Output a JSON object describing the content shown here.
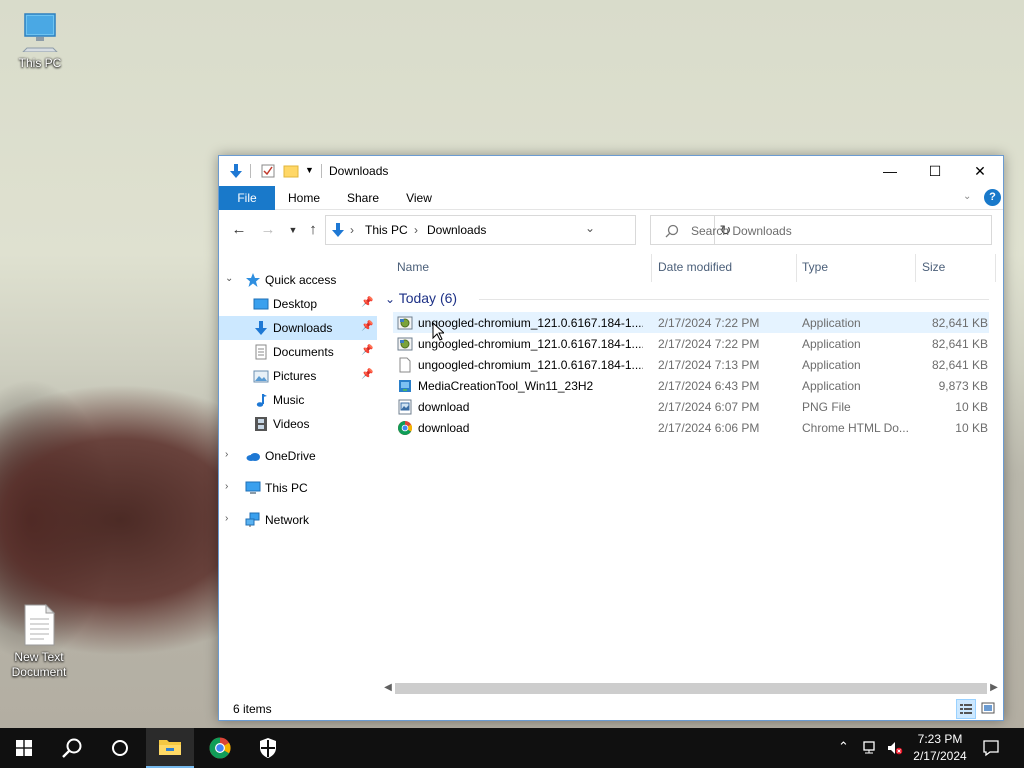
{
  "desktop": {
    "icons": [
      {
        "label": "This PC"
      },
      {
        "label": "New Text Document"
      }
    ]
  },
  "window": {
    "title": "Downloads",
    "controls": {
      "minimize": "—",
      "maximize": "☐",
      "close": "✕"
    }
  },
  "ribbon": {
    "tabs": [
      "File",
      "Home",
      "Share",
      "View"
    ],
    "help": "?"
  },
  "address": {
    "crumbs": [
      "This PC",
      "Downloads"
    ],
    "search_placeholder": "Search Downloads"
  },
  "navpane": {
    "items": [
      {
        "label": "Quick access"
      },
      {
        "label": "Desktop"
      },
      {
        "label": "Downloads"
      },
      {
        "label": "Documents"
      },
      {
        "label": "Pictures"
      },
      {
        "label": "Music"
      },
      {
        "label": "Videos"
      },
      {
        "label": "OneDrive"
      },
      {
        "label": "This PC"
      },
      {
        "label": "Network"
      }
    ]
  },
  "columns": [
    "Name",
    "Date modified",
    "Type",
    "Size"
  ],
  "group": {
    "label": "Today (6)"
  },
  "files": [
    {
      "name": "ungoogled-chromium_121.0.6167.184-1....",
      "date": "2/17/2024 7:22 PM",
      "type": "Application",
      "size": "82,641 KB",
      "icon": "installer-icon"
    },
    {
      "name": "ungoogled-chromium_121.0.6167.184-1....",
      "date": "2/17/2024 7:22 PM",
      "type": "Application",
      "size": "82,641 KB",
      "icon": "installer-icon"
    },
    {
      "name": "ungoogled-chromium_121.0.6167.184-1....",
      "date": "2/17/2024 7:13 PM",
      "type": "Application",
      "size": "82,641 KB",
      "icon": "blank-file-icon"
    },
    {
      "name": "MediaCreationTool_Win11_23H2",
      "date": "2/17/2024 6:43 PM",
      "type": "Application",
      "size": "9,873 KB",
      "icon": "media-creation-icon"
    },
    {
      "name": "download",
      "date": "2/17/2024 6:07 PM",
      "type": "PNG File",
      "size": "10 KB",
      "icon": "image-file-icon"
    },
    {
      "name": "download",
      "date": "2/17/2024 6:06 PM",
      "type": "Chrome HTML Do...",
      "size": "10 KB",
      "icon": "chrome-icon"
    }
  ],
  "status": {
    "count": "6 items"
  },
  "taskbar": {
    "time": "7:23 PM",
    "date": "2/17/2024"
  },
  "colors": {
    "accent": "#1979ca",
    "selection": "#cce8ff",
    "hover": "#e5f3ff",
    "group_header": "#1e3287"
  }
}
